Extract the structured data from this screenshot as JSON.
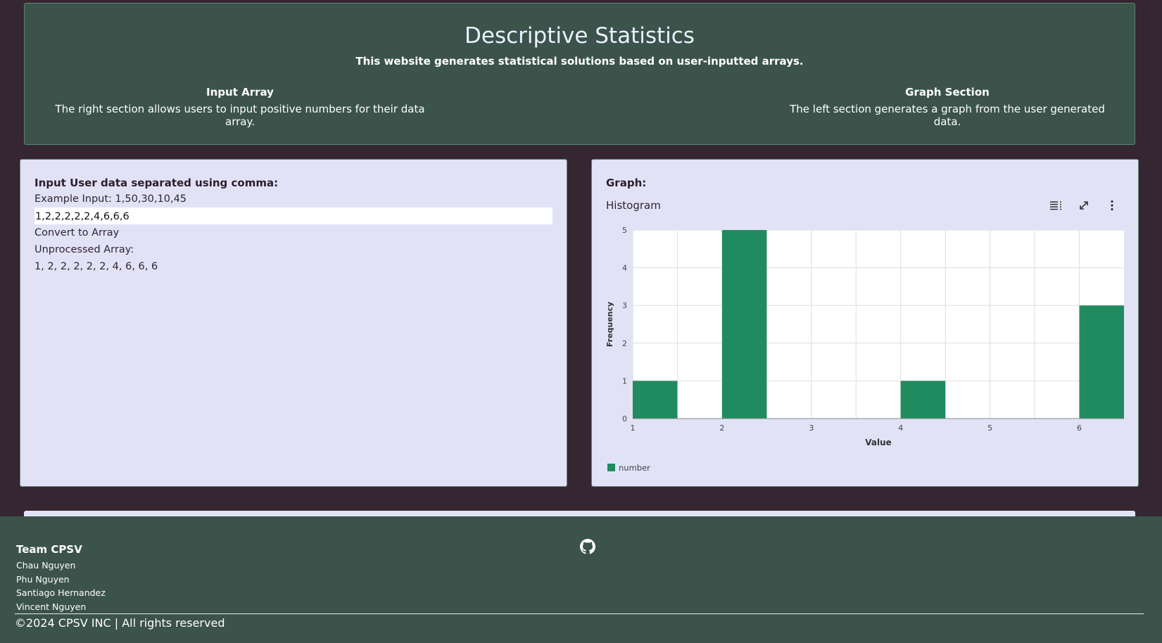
{
  "header": {
    "title": "Descriptive Statistics",
    "subtitle": "This website generates statistical solutions based on user-inputted arrays.",
    "features": [
      {
        "title": "Input Array",
        "text": "The right section allows users to input positive numbers for their data array."
      },
      {
        "title": "Graph Section",
        "text": "The left section generates a graph from the user generated data."
      }
    ]
  },
  "input_panel": {
    "label": "Input User data separated using comma:",
    "example": "Example Input: 1,50,30,10,45",
    "value": "1,2,2,2,2,2,4,6,6,6",
    "convert_label": "Convert to Array",
    "unprocessed_label": "Unprocessed Array:",
    "unprocessed_value": "1, 2, 2, 2, 2, 2, 4, 6, 6, 6"
  },
  "graph_panel": {
    "label": "Graph:",
    "chart_title": "Histogram",
    "toolbar_icons": [
      "menu-lines-icon",
      "expand-icon",
      "kebab-menu-icon"
    ]
  },
  "chart_data": {
    "type": "bar",
    "title": "Histogram",
    "xlabel": "Value",
    "ylabel": "Frequency",
    "bins": [
      {
        "start": 1,
        "end": 1.5,
        "value": 1
      },
      {
        "start": 1.5,
        "end": 2,
        "value": 0
      },
      {
        "start": 2,
        "end": 2.5,
        "value": 5
      },
      {
        "start": 2.5,
        "end": 3,
        "value": 0
      },
      {
        "start": 3,
        "end": 3.5,
        "value": 0
      },
      {
        "start": 3.5,
        "end": 4,
        "value": 0
      },
      {
        "start": 4,
        "end": 4.5,
        "value": 1
      },
      {
        "start": 4.5,
        "end": 5,
        "value": 0
      },
      {
        "start": 5,
        "end": 5.5,
        "value": 0
      },
      {
        "start": 5.5,
        "end": 6,
        "value": 0
      },
      {
        "start": 6,
        "end": 6.5,
        "value": 3
      }
    ],
    "xticks": [
      1,
      2,
      3,
      4,
      5,
      6
    ],
    "yticks": [
      0,
      1,
      2,
      3,
      4,
      5
    ],
    "xlim": [
      1,
      6.5
    ],
    "ylim": [
      0,
      5
    ],
    "grid": true,
    "legend": "bottom-left",
    "series": [
      {
        "name": "number",
        "color": "#218b60"
      }
    ]
  },
  "footer": {
    "team_title": "Team CPSV",
    "members": [
      "Chau Nguyen",
      "Phu Nguyen",
      "Santiago Hernandez",
      "Vincent Nguyen"
    ],
    "copyright": "©2024 CPSV INC | All rights reserved",
    "icon": "github-icon"
  },
  "colors": {
    "background": "#352631",
    "header_bg": "#3b534a",
    "panel_bg": "#e2e2f7",
    "bar": "#218b60"
  }
}
